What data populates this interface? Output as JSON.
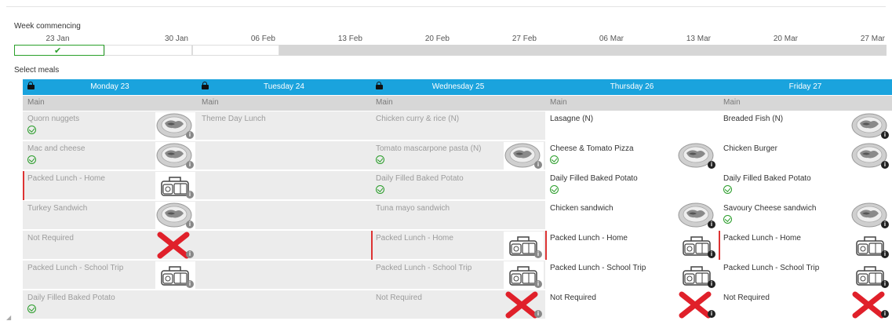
{
  "week_commencing_label": "Week commencing",
  "weeks": [
    "23 Jan",
    "30 Jan",
    "06 Feb",
    "13 Feb",
    "20 Feb",
    "27 Feb",
    "06 Mar",
    "13 Mar",
    "20 Mar",
    "27 Mar"
  ],
  "selected_week_check": "✔",
  "select_meals_label": "Select meals",
  "colors": {
    "accent": "#1aa3dd",
    "veg": "#2a9d2a",
    "cross": "#e0202a",
    "selected_border": "#2aa02a"
  },
  "days": [
    {
      "name": "Monday 23",
      "locked": true,
      "section": "Main",
      "meals": [
        {
          "name": "Quorn nuggets",
          "veg": true,
          "icon": "plate-icon",
          "bar": false,
          "state": "grey"
        },
        {
          "name": "Mac and cheese",
          "veg": true,
          "icon": "plate-icon",
          "bar": false,
          "state": "grey"
        },
        {
          "name": "Packed Lunch - Home",
          "veg": false,
          "icon": "lunchbox-icon",
          "bar": true,
          "state": "grey"
        },
        {
          "name": "Turkey Sandwich",
          "veg": false,
          "icon": "plate-icon",
          "bar": false,
          "state": "grey"
        },
        {
          "name": "Not Required",
          "veg": false,
          "icon": "cross-icon",
          "bar": false,
          "state": "grey"
        },
        {
          "name": "Packed Lunch - School Trip",
          "veg": false,
          "icon": "lunchbox-icon",
          "bar": false,
          "state": "grey"
        },
        {
          "name": "Daily Filled Baked Potato",
          "veg": true,
          "icon": "",
          "bar": false,
          "state": "grey"
        }
      ]
    },
    {
      "name": "Tuesday 24",
      "locked": true,
      "section": "Main",
      "meals": [
        {
          "name": "Theme Day Lunch",
          "veg": false,
          "icon": "",
          "bar": false,
          "state": "grey"
        },
        {
          "name": "",
          "veg": false,
          "icon": "",
          "bar": false,
          "state": "grey"
        },
        {
          "name": "",
          "veg": false,
          "icon": "",
          "bar": false,
          "state": "grey"
        },
        {
          "name": "",
          "veg": false,
          "icon": "",
          "bar": false,
          "state": "grey"
        },
        {
          "name": "",
          "veg": false,
          "icon": "",
          "bar": false,
          "state": "grey"
        },
        {
          "name": "",
          "veg": false,
          "icon": "",
          "bar": false,
          "state": "grey"
        },
        {
          "name": "",
          "veg": false,
          "icon": "",
          "bar": false,
          "state": "grey"
        }
      ]
    },
    {
      "name": "Wednesday 25",
      "locked": true,
      "section": "Main",
      "meals": [
        {
          "name": "Chicken curry & rice (N)",
          "veg": false,
          "icon": "",
          "bar": false,
          "state": "grey"
        },
        {
          "name": "Tomato mascarpone pasta (N)",
          "veg": true,
          "icon": "plate-icon",
          "bar": false,
          "state": "grey"
        },
        {
          "name": "Daily Filled Baked Potato",
          "veg": true,
          "icon": "",
          "bar": false,
          "state": "grey"
        },
        {
          "name": "Tuna mayo sandwich",
          "veg": false,
          "icon": "",
          "bar": false,
          "state": "grey"
        },
        {
          "name": "Packed Lunch - Home",
          "veg": false,
          "icon": "lunchbox-icon",
          "bar": true,
          "state": "grey"
        },
        {
          "name": "Packed Lunch - School Trip",
          "veg": false,
          "icon": "lunchbox-icon",
          "bar": false,
          "state": "grey"
        },
        {
          "name": "Not Required",
          "veg": false,
          "icon": "cross-icon",
          "bar": false,
          "state": "grey"
        }
      ]
    },
    {
      "name": "Thursday 26",
      "locked": false,
      "section": "Main",
      "meals": [
        {
          "name": "Lasagne (N)",
          "veg": false,
          "icon": "",
          "bar": false,
          "state": "white"
        },
        {
          "name": "Cheese & Tomato Pizza",
          "veg": true,
          "icon": "plate-icon",
          "bar": false,
          "state": "white"
        },
        {
          "name": "Daily Filled Baked Potato",
          "veg": true,
          "icon": "",
          "bar": false,
          "state": "white"
        },
        {
          "name": "Chicken sandwich",
          "veg": false,
          "icon": "plate-icon",
          "bar": false,
          "state": "white"
        },
        {
          "name": "Packed Lunch - Home",
          "veg": false,
          "icon": "lunchbox-icon",
          "bar": true,
          "state": "white"
        },
        {
          "name": "Packed Lunch - School Trip",
          "veg": false,
          "icon": "lunchbox-icon",
          "bar": false,
          "state": "white"
        },
        {
          "name": "Not Required",
          "veg": false,
          "icon": "cross-icon",
          "bar": false,
          "state": "white"
        }
      ]
    },
    {
      "name": "Friday 27",
      "locked": false,
      "section": "Main",
      "meals": [
        {
          "name": "Breaded Fish (N)",
          "veg": false,
          "icon": "plate-icon",
          "bar": false,
          "state": "white"
        },
        {
          "name": "Chicken Burger",
          "veg": false,
          "icon": "plate-icon",
          "bar": false,
          "state": "white"
        },
        {
          "name": "Daily Filled Baked Potato",
          "veg": true,
          "icon": "",
          "bar": false,
          "state": "white"
        },
        {
          "name": "Savoury Cheese sandwich",
          "veg": true,
          "icon": "plate-icon",
          "bar": false,
          "state": "white"
        },
        {
          "name": "Packed Lunch - Home",
          "veg": false,
          "icon": "lunchbox-icon",
          "bar": true,
          "state": "white"
        },
        {
          "name": "Packed Lunch - School Trip",
          "veg": false,
          "icon": "lunchbox-icon",
          "bar": false,
          "state": "white"
        },
        {
          "name": "Not Required",
          "veg": false,
          "icon": "cross-icon",
          "bar": false,
          "state": "white"
        }
      ]
    }
  ]
}
